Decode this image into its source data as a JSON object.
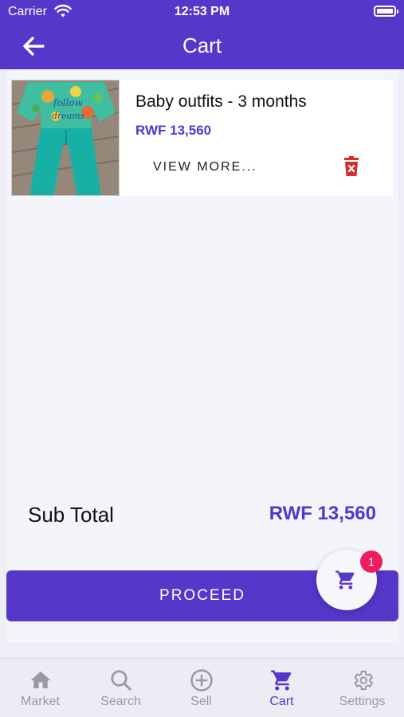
{
  "status_bar": {
    "carrier": "Carrier",
    "time": "12:53 PM"
  },
  "nav": {
    "title": "Cart",
    "back_icon": "arrow-left-icon"
  },
  "cart": {
    "items": [
      {
        "name": "Baby outfits - 3 months",
        "price": "RWF 13,560",
        "view_more_label": "VIEW MORE...",
        "delete_icon": "trash-icon"
      }
    ],
    "subtotal_label": "Sub Total",
    "subtotal_value": "RWF 13,560",
    "proceed_label": "PROCEED",
    "cart_badge_count": "1"
  },
  "tabs": [
    {
      "label": "Market",
      "icon": "home-icon",
      "active": false
    },
    {
      "label": "Search",
      "icon": "search-icon",
      "active": false
    },
    {
      "label": "Sell",
      "icon": "add-circle-icon",
      "active": false
    },
    {
      "label": "Cart",
      "icon": "cart-icon",
      "active": true
    },
    {
      "label": "Settings",
      "icon": "gear-icon",
      "active": false
    }
  ],
  "colors": {
    "primary": "#5537c9",
    "badge": "#ee1d5e",
    "delete": "#d32f2f",
    "inactive_tab": "#9a9aa6"
  }
}
